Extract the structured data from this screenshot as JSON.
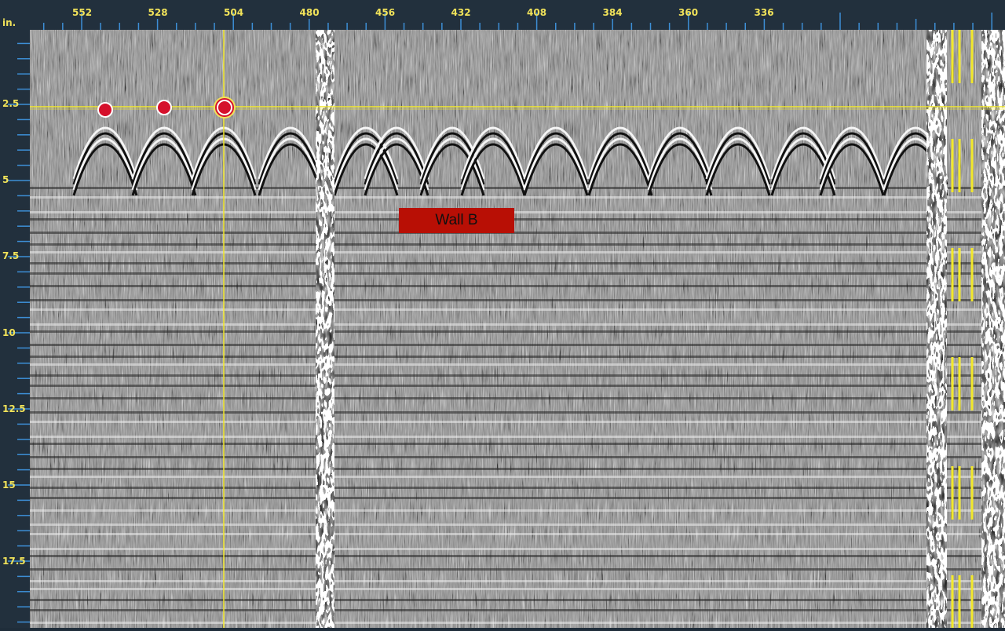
{
  "ruler": {
    "unit": "in.",
    "top_ticks": [
      "552",
      "528",
      "504",
      "480",
      "456",
      "432",
      "408",
      "384",
      "360",
      "336"
    ],
    "left_ticks": [
      "2.5",
      "5",
      "7.5",
      "10",
      "12.5",
      "15",
      "17.5"
    ]
  },
  "scan": {
    "label": "Wall B"
  },
  "colors": {
    "ruler_bg": "#22303d",
    "ruler_text": "#f1e35a",
    "tick": "#3d8fd6",
    "crosshair": "#f2e82b",
    "marker": "#d5102b",
    "label_bg": "#b80f05"
  },
  "markers": [
    {
      "name": "target-1",
      "selected": false
    },
    {
      "name": "target-2",
      "selected": false
    },
    {
      "name": "target-3",
      "selected": true
    }
  ]
}
